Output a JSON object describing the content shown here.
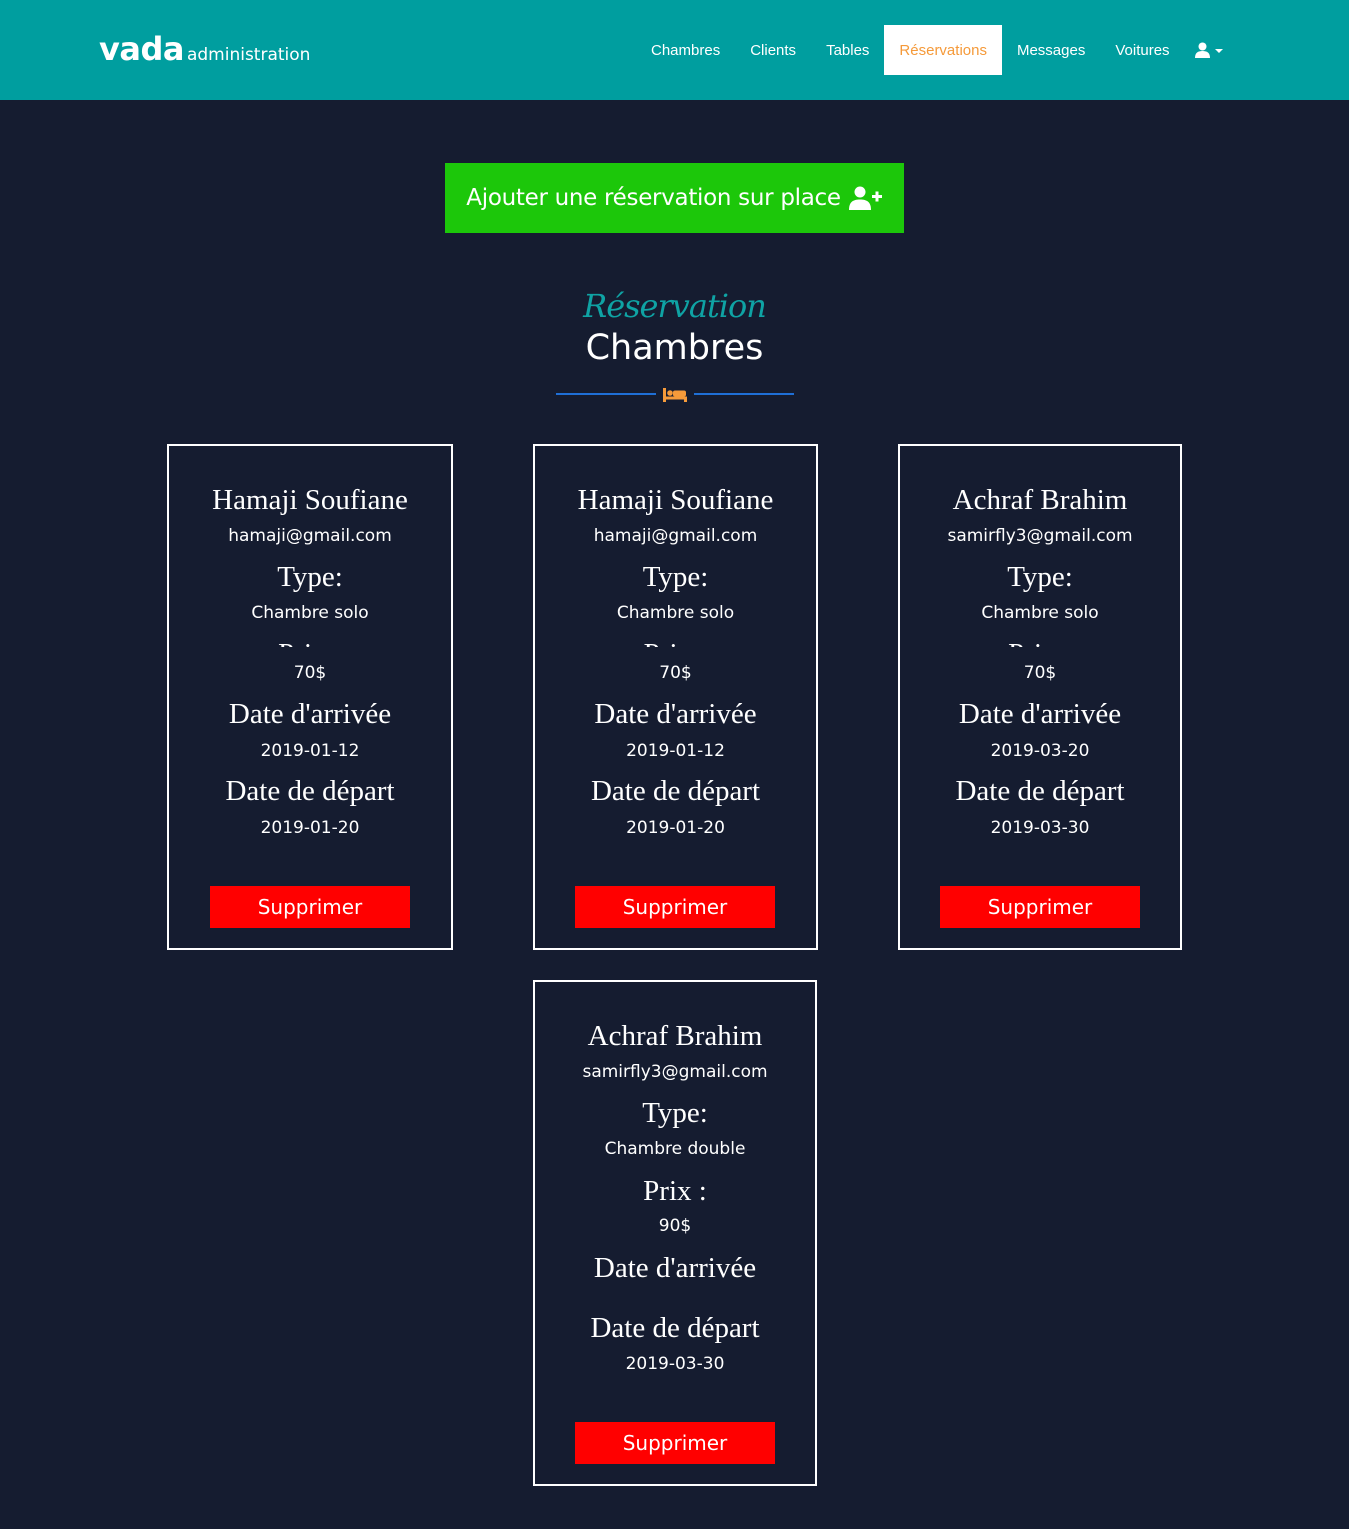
{
  "brand": {
    "main": "vada",
    "sub": "administration"
  },
  "nav": {
    "items": [
      {
        "label": "Chambres",
        "active": false
      },
      {
        "label": "Clients",
        "active": false
      },
      {
        "label": "Tables",
        "active": false
      },
      {
        "label": "Réservations",
        "active": true
      },
      {
        "label": "Messages",
        "active": false
      },
      {
        "label": "Voitures",
        "active": false
      }
    ],
    "user_icon": "user-icon"
  },
  "add_button": {
    "label": "Ajouter une réservation sur place",
    "icon": "user-plus-icon"
  },
  "section": {
    "subheading": "Réservation",
    "heading": "Chambres",
    "icon": "bed-icon"
  },
  "labels": {
    "type": "Type:",
    "price": "Prix :",
    "arrival": "Date d'arrivée",
    "departure": "Date de départ",
    "delete": "Supprimer"
  },
  "reservations": [
    {
      "name": "Hamaji Soufiane",
      "email": "hamaji@gmail.com",
      "type": "Chambre solo",
      "price": "70$",
      "arrival": "2019-01-12",
      "departure": "2019-01-20"
    },
    {
      "name": "Hamaji Soufiane",
      "email": "hamaji@gmail.com",
      "type": "Chambre solo",
      "price": "70$",
      "arrival": "2019-01-12",
      "departure": "2019-01-20"
    },
    {
      "name": "Achraf Brahim",
      "email": "samirfly3@gmail.com",
      "type": "Chambre solo",
      "price": "70$",
      "arrival": "2019-03-20",
      "departure": "2019-03-30"
    },
    {
      "name": "Achraf Brahim",
      "email": "samirfly3@gmail.com",
      "type": "Chambre double",
      "price": "90$",
      "arrival": "",
      "departure": "2019-03-30"
    }
  ],
  "colors": {
    "navbar": "#009e9f",
    "background": "#151c30",
    "active_nav_text": "#f59a3a",
    "add_button": "#1cc70a",
    "delete_button": "#ff0000",
    "accent_teal": "#0fa3a4",
    "divider_blue": "#1f6fd6",
    "bed_icon": "#f59a3a"
  }
}
